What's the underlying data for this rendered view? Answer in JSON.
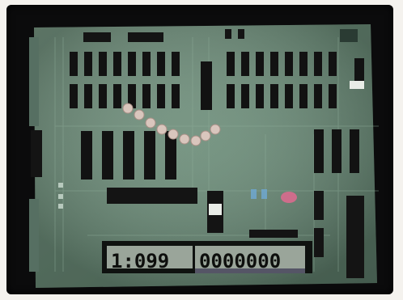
{
  "scene": {
    "description_labels": {
      "board": "circuit-board",
      "display_time": "1:099",
      "display_count": "0000000"
    },
    "colors": {
      "board": "#6f8f7c",
      "board_dark": "#4f6b5c",
      "chip": "#141414",
      "display_bg": "#9aa59a",
      "bezel": "#0b0b0c",
      "bead": "#d9c6bd",
      "led_pink": "#e06a8f",
      "led_blue": "#6fa7cf"
    }
  },
  "display": {
    "time": "1:099",
    "count": "0000000"
  }
}
